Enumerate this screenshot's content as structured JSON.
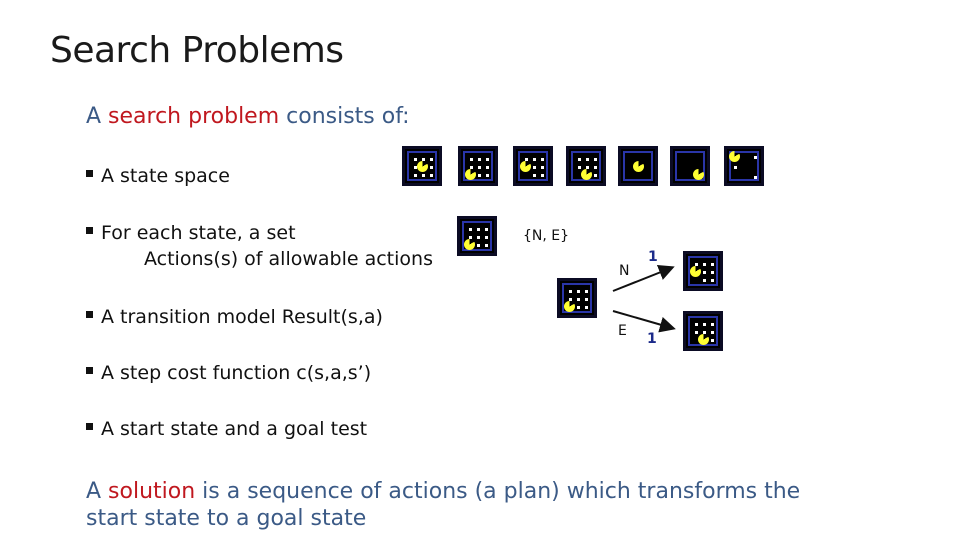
{
  "slide": {
    "title": "Search Problems",
    "intro": {
      "prefix": "A ",
      "highlight": "search problem",
      "suffix": " consists of:"
    },
    "bullets": [
      {
        "text": "A state space"
      },
      {
        "text": "For each state, a set",
        "sub": "Actions(s) of allowable actions"
      },
      {
        "text": "A transition model Result(s,a)"
      },
      {
        "text": "A step cost function c(s,a,s’)"
      },
      {
        "text": "A start state and a goal test"
      }
    ],
    "solution": {
      "prefix": "A ",
      "highlight": "solution",
      "suffix": " is a sequence of actions (a plan) which transforms the start state to a goal state"
    }
  },
  "diagram": {
    "actions_label": "{N, E}",
    "edges": [
      {
        "action": "N",
        "cost": "1"
      },
      {
        "action": "E",
        "cost": "1"
      }
    ],
    "state_space_tiles": 7,
    "icons": {
      "state": "pacman-grid-icon",
      "arrow": "arrow-icon"
    }
  },
  "colors": {
    "accent_red": "#c0181f",
    "body_blue": "#3b5a86",
    "cost_blue": "#1c2b8a",
    "pacman_yellow": "#ffff33",
    "maze_wall": "#2a35a8"
  }
}
